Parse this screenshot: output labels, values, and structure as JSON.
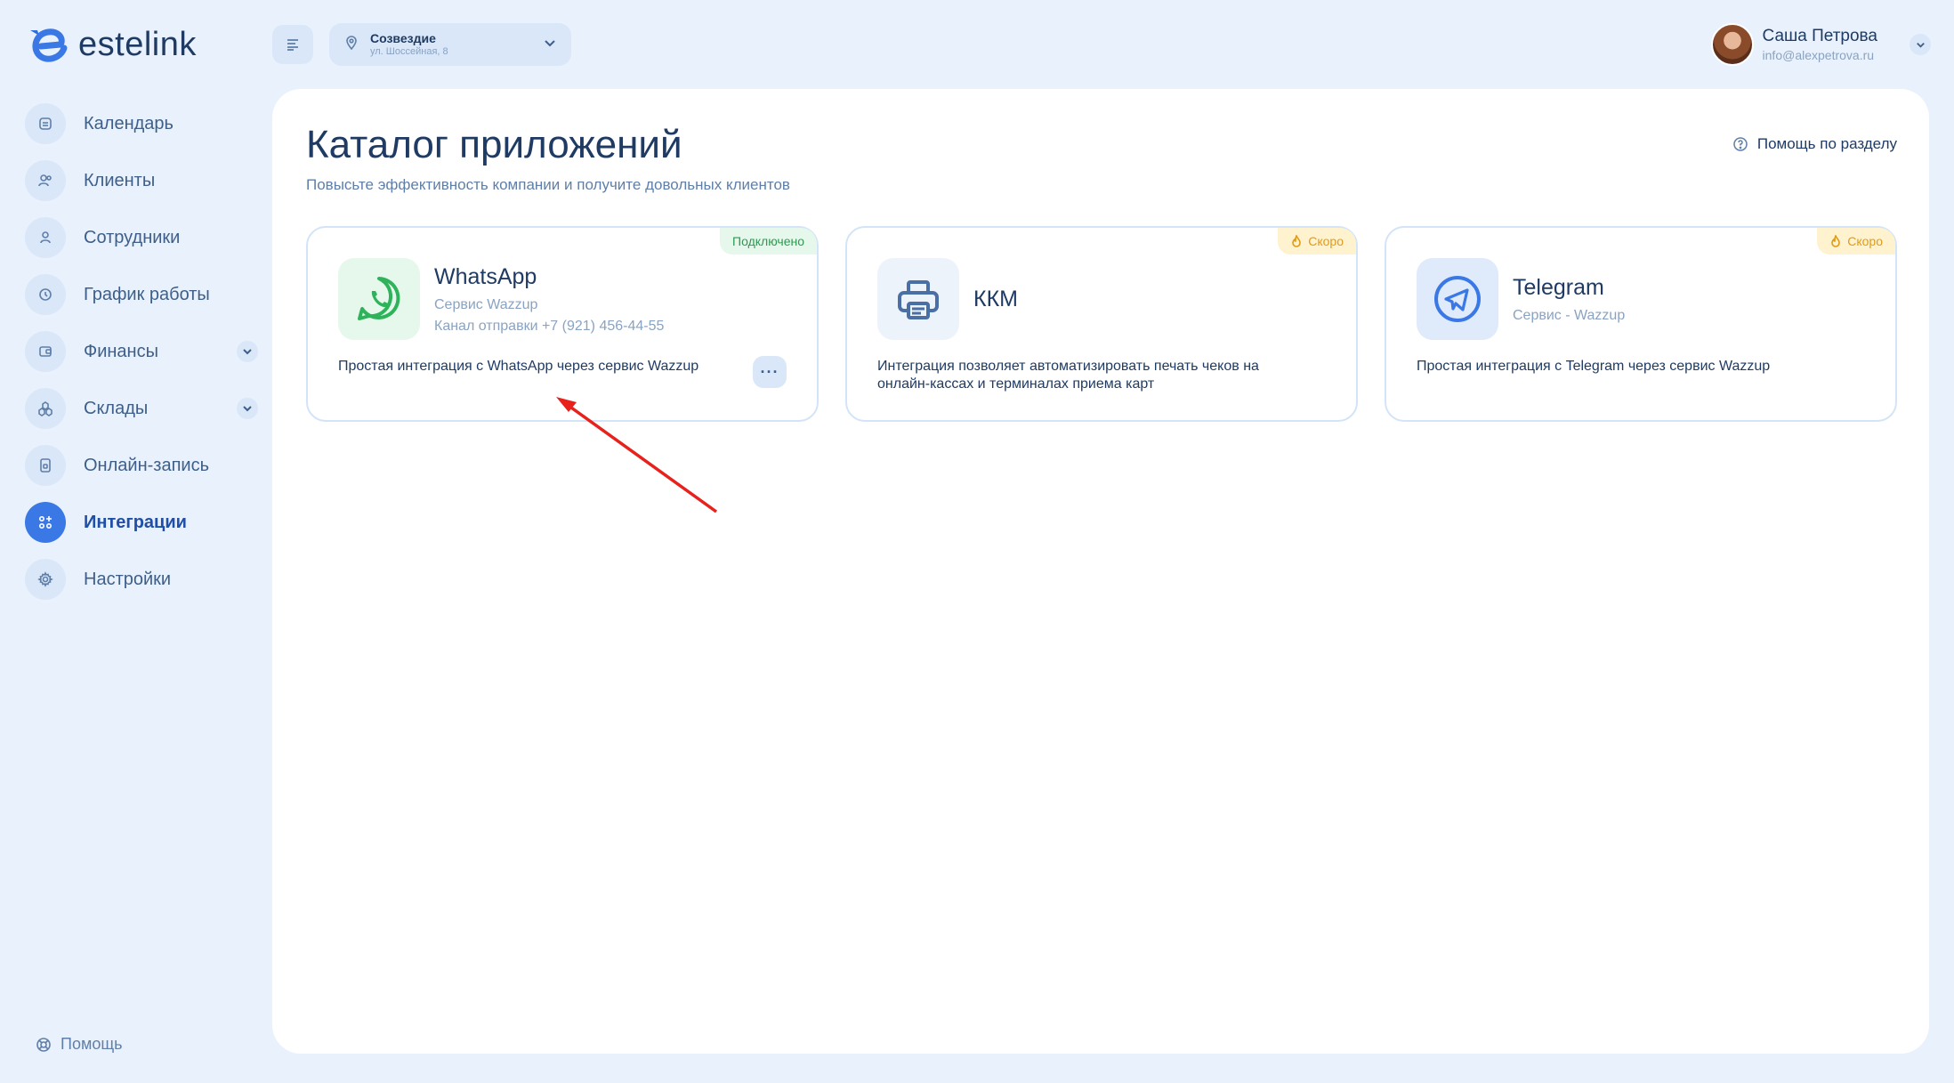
{
  "brand": {
    "logo_text": "estelink"
  },
  "sidebar": {
    "items": [
      {
        "label": "Календарь"
      },
      {
        "label": "Клиенты"
      },
      {
        "label": "Сотрудники"
      },
      {
        "label": "График работы"
      },
      {
        "label": "Финансы"
      },
      {
        "label": "Склады"
      },
      {
        "label": "Онлайн-запись"
      },
      {
        "label": "Интеграции"
      },
      {
        "label": "Настройки"
      }
    ],
    "help_label": "Помощь"
  },
  "header": {
    "location": {
      "name": "Созвездие",
      "address": "ул. Шоссейная, 8"
    },
    "user": {
      "name": "Саша Петрова",
      "email": "info@alexpetrova.ru"
    }
  },
  "main": {
    "title": "Каталог приложений",
    "subtitle": "Повысьте эффективность компании и получите довольных клиентов",
    "help_label": "Помощь по разделу",
    "cards": [
      {
        "name": "WhatsApp",
        "meta": "Сервис Wazzup",
        "meta2": "Канал отправки +7 (921) 456-44-55",
        "description": "Простая интеграция с WhatsApp через сервис Wazzup",
        "badge": "Подключено",
        "more_label": "···"
      },
      {
        "name": "ККМ",
        "description": "Интеграция позволяет автоматизировать печать чеков на онлайн-кассах и терминалах приема карт",
        "badge": "Скоро"
      },
      {
        "name": "Telegram",
        "meta": "Сервис - Wazzup",
        "description": "Простая интеграция с Telegram через сервис Wazzup",
        "badge": "Скоро"
      }
    ]
  },
  "colors": {
    "accent": "#3a78e6",
    "background": "#e8f1fc",
    "connected": "#2c9a50",
    "soon": "#e09a1a",
    "annotation_arrow": "#e8211d"
  }
}
